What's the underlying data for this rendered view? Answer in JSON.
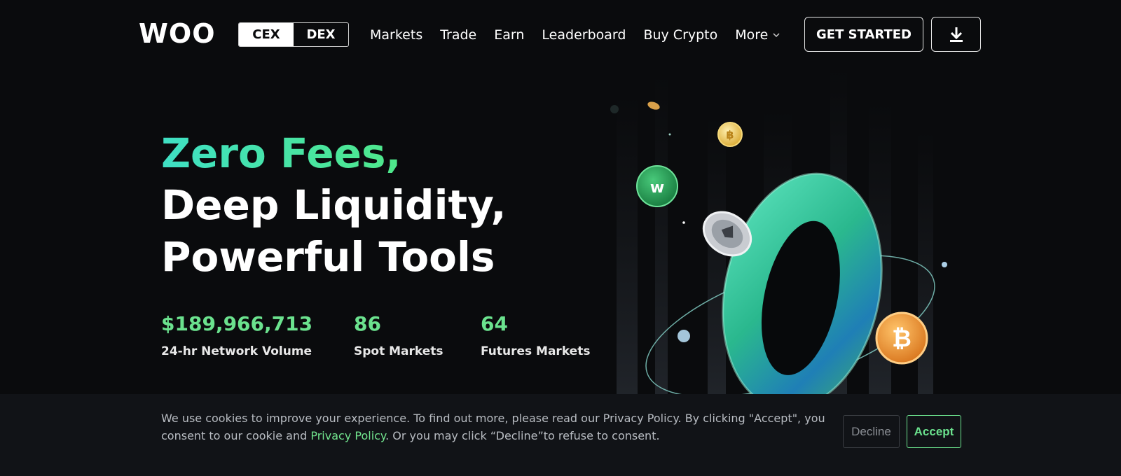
{
  "header": {
    "logo_text": "WOO",
    "switch": {
      "cex_label": "CEX",
      "dex_label": "DEX",
      "active": "CEX"
    },
    "nav": [
      {
        "label": "Markets"
      },
      {
        "label": "Trade"
      },
      {
        "label": "Earn"
      },
      {
        "label": "Leaderboard"
      },
      {
        "label": "Buy Crypto"
      },
      {
        "label": "More"
      }
    ],
    "get_started_label": "GET STARTED",
    "download_icon": "download-icon"
  },
  "hero": {
    "line1": "Zero Fees,",
    "line2": "Deep Liquidity,",
    "line3": "Powerful Tools"
  },
  "stats": [
    {
      "value": "$189,966,713",
      "label": "24-hr Network Volume"
    },
    {
      "value": "86",
      "label": "Spot Markets"
    },
    {
      "value": "64",
      "label": "Futures Markets"
    }
  ],
  "cookie": {
    "text_part1": "We use cookies to improve your experience. To find out more, please read our Privacy Policy. By clicking \"Accept\", you consent to our cookie and ",
    "link_label": "Privacy Policy",
    "text_part2": ". Or you may click “Decline”to refuse to consent.",
    "decline_label": "Decline",
    "accept_label": "Accept"
  },
  "colors": {
    "background": "#0a0b0d",
    "accent_green": "#6be28e",
    "gradient_start": "#3fe0c4",
    "gradient_end": "#5af06a",
    "cookie_bg": "#111317"
  }
}
